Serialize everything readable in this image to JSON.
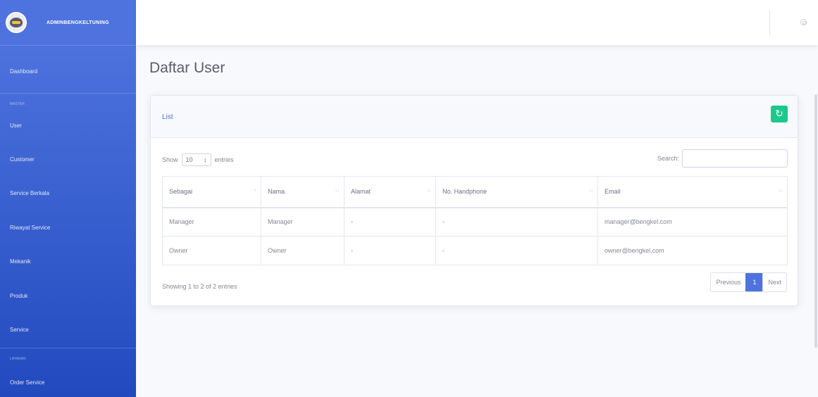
{
  "brand": {
    "name": "ADMINBENGKELTUNING"
  },
  "sidebar": {
    "dashboard": "Dashboard",
    "heading_master": "MASTER",
    "items": [
      "User",
      "Customer",
      "Service Berkala",
      "Riwayat Service",
      "Mekanik",
      "Produk",
      "Service"
    ],
    "heading_layanan": "LAYANAN",
    "order_service": "Order Service"
  },
  "page": {
    "title": "Daftar User"
  },
  "card": {
    "header": "List",
    "refresh_icon": "refresh-icon"
  },
  "table_controls": {
    "show_label": "Show",
    "length_value": "10",
    "entries_label": "entries",
    "search_label": "Search:",
    "search_value": ""
  },
  "table": {
    "columns": [
      "Sebagai",
      "Nama",
      "Alamat",
      "No. Handphone",
      "Email"
    ],
    "rows": [
      [
        "Manager",
        "Manager",
        "-",
        "-",
        "manager@bengkel.com"
      ],
      [
        "Owner",
        "Owner",
        "-",
        "-",
        "owner@bengkel.com"
      ]
    ]
  },
  "footer": {
    "info": "Showing 1 to 2 of 2 entries",
    "previous": "Previous",
    "page": "1",
    "next": "Next"
  },
  "colors": {
    "sidebar_top": "#4e73df",
    "sidebar_bottom": "#224abe",
    "accent": "#4e73df",
    "success": "#1cc88a"
  }
}
